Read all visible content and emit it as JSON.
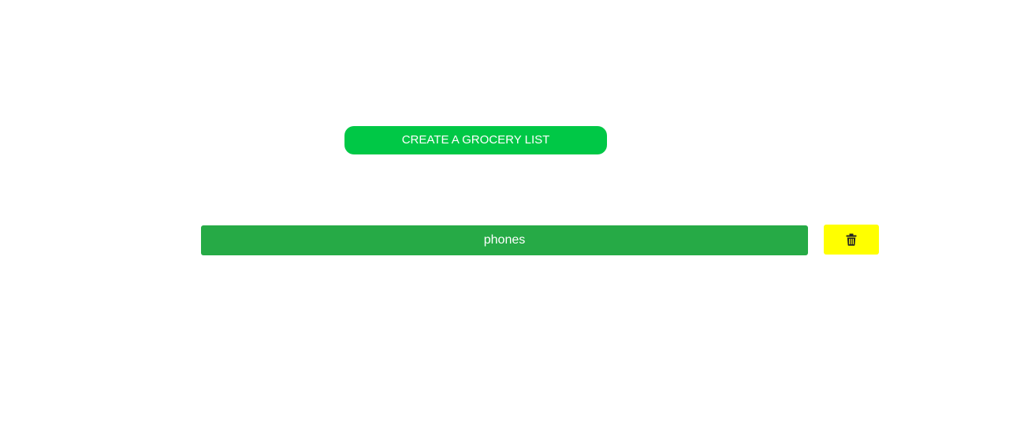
{
  "colors": {
    "create_button_bg": "#00c846",
    "list_item_bg": "#26aa46",
    "delete_button_bg": "#ffff00",
    "icon_color": "#222222",
    "text_color": "#ffffff"
  },
  "create_button": {
    "label": "CREATE A GROCERY LIST"
  },
  "list": {
    "items": [
      {
        "label": "phones",
        "delete_icon": "trash-icon"
      }
    ]
  }
}
